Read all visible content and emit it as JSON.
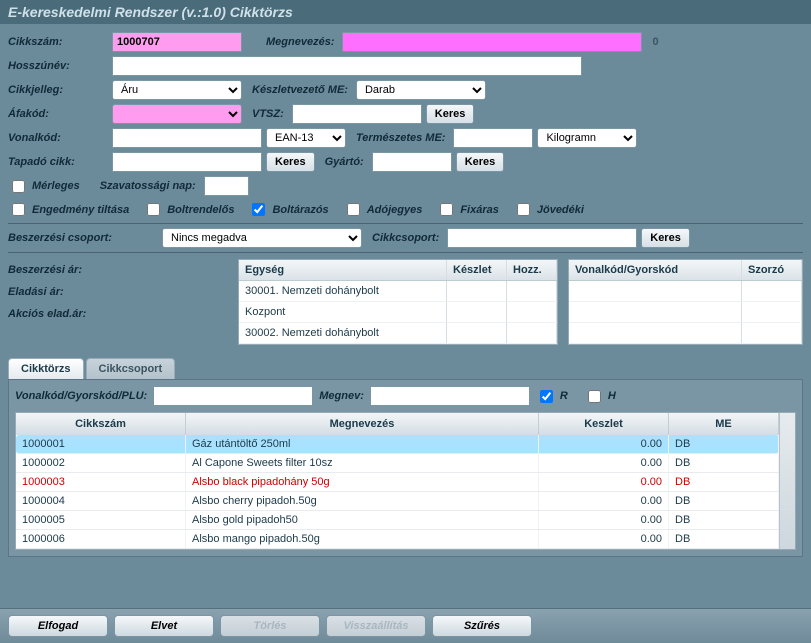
{
  "title": "E-kereskedelmi Rendszer (v.:1.0)   Cikktörzs",
  "form": {
    "cikkszam_lbl": "Cikkszám:",
    "cikkszam": "1000707",
    "megnevezes_lbl": "Megnevezés:",
    "megnevezes": "",
    "meg_counter": "0",
    "hosszunev_lbl": "Hosszúnév:",
    "hosszunev": "",
    "cikkjelleg_lbl": "Cikkjelleg:",
    "cikkjelleg": "Áru",
    "keszletvezeto_lbl": "Készletvezető ME:",
    "keszletvezeto": "Darab",
    "afakod_lbl": "Áfakód:",
    "afakod": "",
    "vtsz_lbl": "VTSZ:",
    "vtsz": "",
    "keres": "Keres",
    "vonalkod_lbl": "Vonalkód:",
    "vonalkod": "",
    "ean": "EAN-13",
    "term_me_lbl": "Természetes ME:",
    "term_me": "",
    "kilo": "Kilogramn",
    "tapado_lbl": "Tapadó cikk:",
    "tapado": "",
    "gyarto_lbl": "Gyártó:",
    "gyarto": "",
    "merleges": "Mérleges",
    "szavnap_lbl": "Szavatossági nap:",
    "szavnap": "",
    "chk": {
      "engedmeny": "Engedmény tiltása",
      "boltrendelos": "Boltrendelős",
      "boltarazos": "Boltárazós",
      "adojegyes": "Adójegyes",
      "fixaras": "Fixáras",
      "jovedeki": "Jövedéki"
    },
    "beszcsop_lbl": "Beszerzési csoport:",
    "beszcsop": "Nincs megadva",
    "cikkcsop_lbl": "Cikkcsoport:",
    "cikkcsop": ""
  },
  "prices": {
    "beszar": "Beszerzési ár:",
    "eladar": "Eladási ár:",
    "akcios": "Akciós elad.ár:"
  },
  "grid_units": {
    "h1": "Egység",
    "h2": "Készlet",
    "h3": "Hozz.",
    "rows": [
      "30001. Nemzeti dohánybolt",
      "Kozpont",
      "30002. Nemzeti dohánybolt"
    ]
  },
  "grid_barcode": {
    "h1": "Vonalkód/Gyorskód",
    "h2": "Szorzó"
  },
  "tabs": {
    "t1": "Cikktörzs",
    "t2": "Cikkcsoport"
  },
  "search": {
    "vonalkod_lbl": "Vonalkód/Gyorskód/PLU:",
    "megnev_lbl": "Megnev:",
    "r": "R",
    "h": "H"
  },
  "list": {
    "h_id": "Cikkszám",
    "h_name": "Megnevezés",
    "h_stock": "Keszlet",
    "h_me": "ME",
    "rows": [
      {
        "id": "1000001",
        "name": "Gáz utántöltő 250ml",
        "stock": "0.00",
        "me": "DB",
        "sel": true
      },
      {
        "id": "1000002",
        "name": "Al Capone Sweets filter 10sz",
        "stock": "0.00",
        "me": "DB"
      },
      {
        "id": "1000003",
        "name": "Alsbo black pipadohány 50g",
        "stock": "0.00",
        "me": "DB",
        "red": true
      },
      {
        "id": "1000004",
        "name": "Alsbo cherry pipadoh.50g",
        "stock": "0.00",
        "me": "DB"
      },
      {
        "id": "1000005",
        "name": "Alsbo gold pipadoh50",
        "stock": "0.00",
        "me": "DB"
      },
      {
        "id": "1000006",
        "name": "Alsbo mango pipadoh.50g",
        "stock": "0.00",
        "me": "DB"
      }
    ]
  },
  "footer": {
    "elfogad": "Elfogad",
    "elvet": "Elvet",
    "torles": "Törlés",
    "vissza": "Visszaállítás",
    "szures": "Szűrés"
  }
}
